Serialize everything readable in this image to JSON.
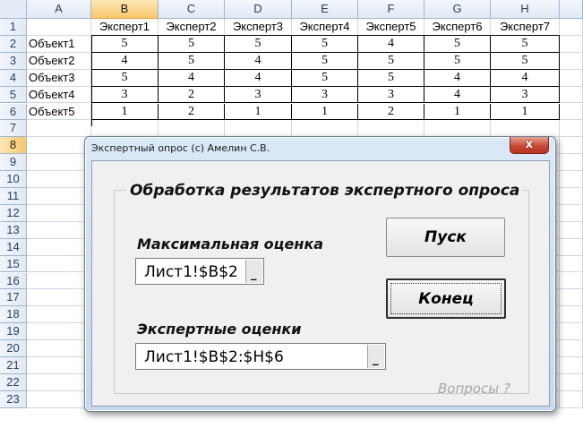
{
  "sheet": {
    "columns": [
      "A",
      "B",
      "C",
      "D",
      "E",
      "F",
      "G",
      "H"
    ],
    "rows": [
      "1",
      "2",
      "3",
      "4",
      "5",
      "6",
      "7",
      "8",
      "9",
      "10",
      "11",
      "12",
      "13",
      "14",
      "15",
      "16",
      "17",
      "18",
      "19",
      "20",
      "21",
      "22",
      "23"
    ],
    "experts": [
      "Эксперт1",
      "Эксперт2",
      "Эксперт3",
      "Эксперт4",
      "Эксперт5",
      "Эксперт6",
      "Эксперт7"
    ],
    "objects": [
      "Объект1",
      "Объект2",
      "Объект3",
      "Объект4",
      "Объект5"
    ],
    "scores": [
      [
        "5",
        "5",
        "5",
        "5",
        "4",
        "5",
        "5"
      ],
      [
        "4",
        "5",
        "4",
        "5",
        "5",
        "5",
        "5"
      ],
      [
        "5",
        "4",
        "4",
        "5",
        "5",
        "4",
        "4"
      ],
      [
        "3",
        "2",
        "3",
        "3",
        "3",
        "4",
        "3"
      ],
      [
        "1",
        "2",
        "1",
        "1",
        "2",
        "1",
        "1"
      ]
    ]
  },
  "dialog": {
    "title": "Экспертный опрос  (c) Амелин С.В.",
    "close_glyph": "x",
    "group_title": "Обработка результатов экспертного опроса",
    "max_label": "Максимальная оценка",
    "max_ref": "Лист1!$B$2",
    "scores_label": "Экспертные оценки",
    "scores_ref": "Лист1!$B$2:$H$6",
    "ref_button_glyph": "_",
    "start_button": "Пуск",
    "end_button": "Конец",
    "help_link": "Вопросы ?"
  }
}
